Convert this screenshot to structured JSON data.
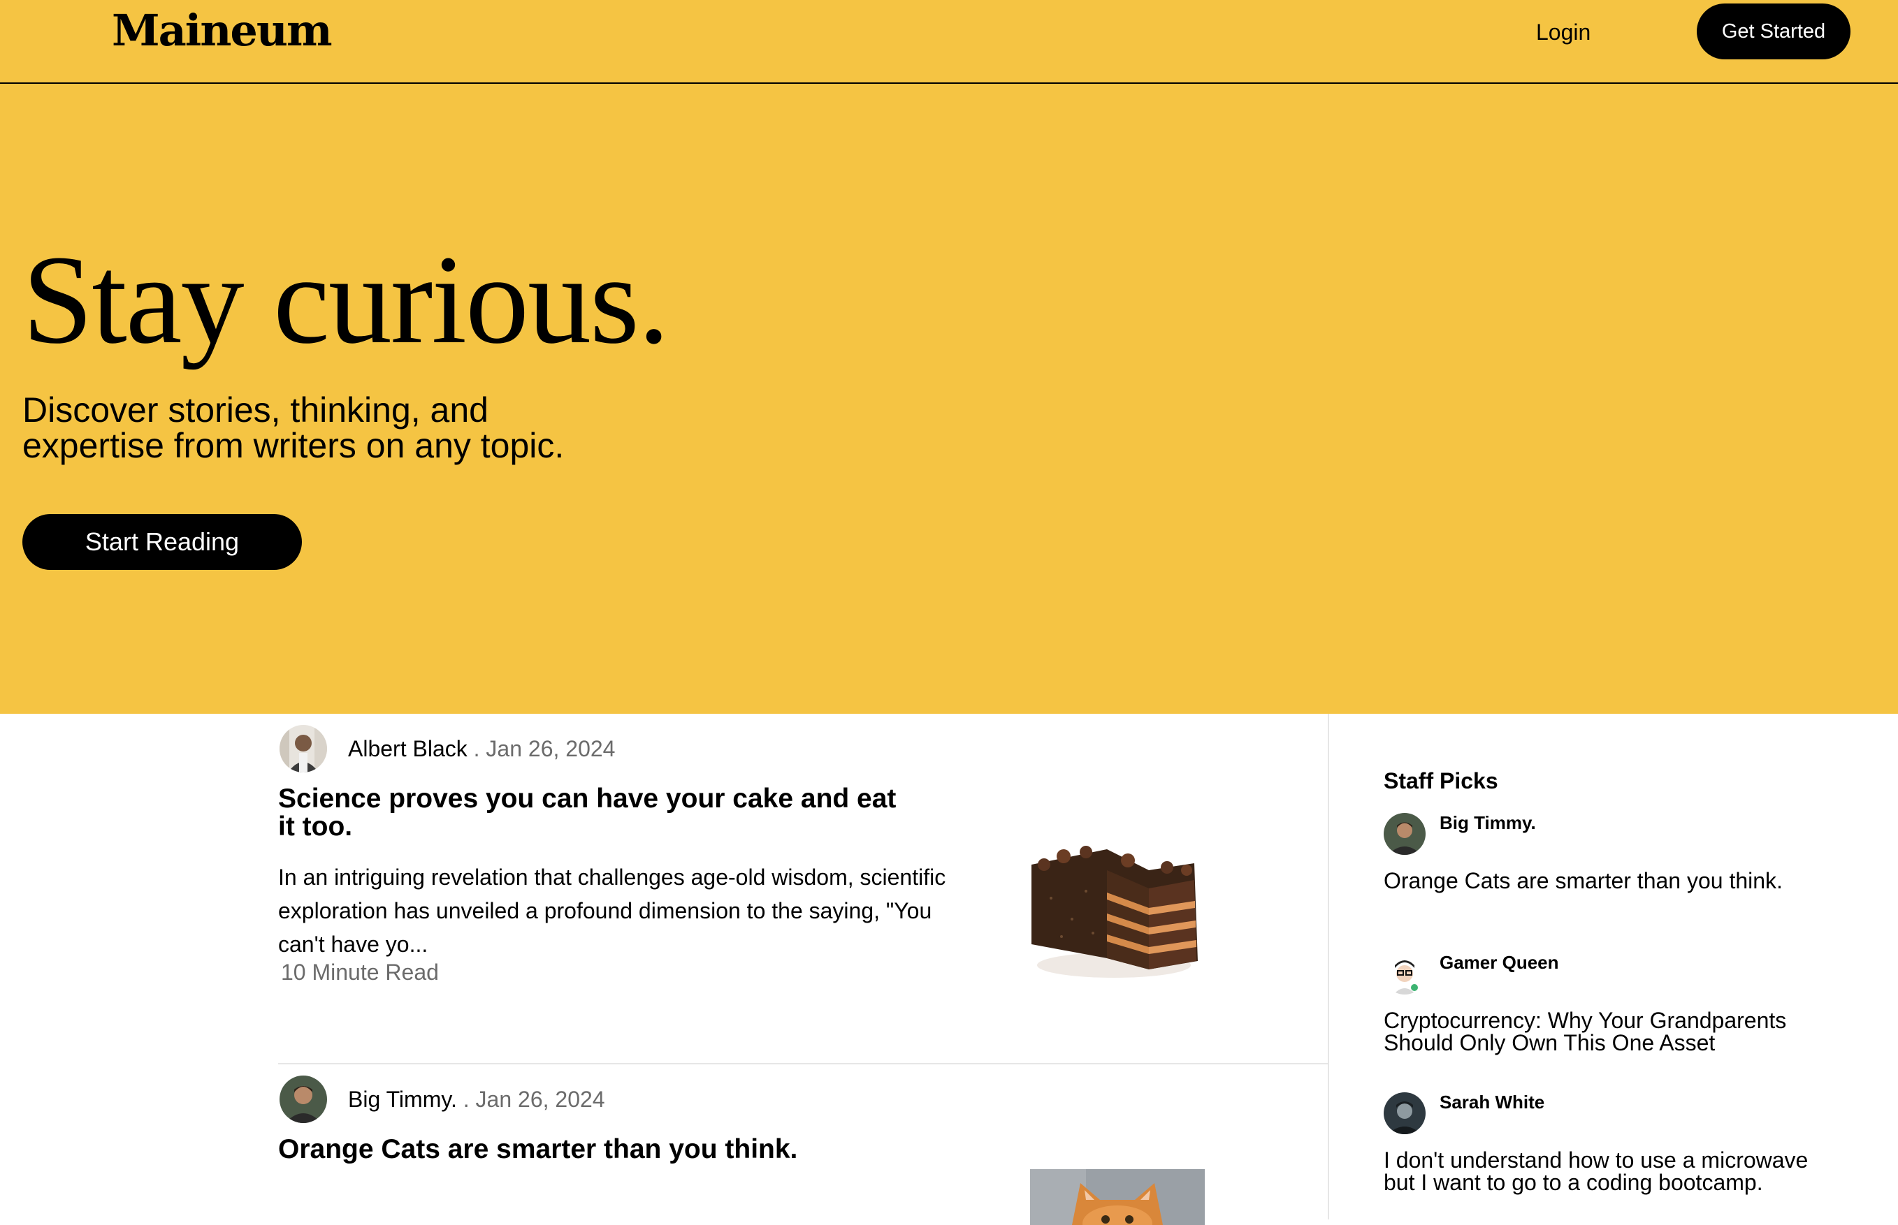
{
  "header": {
    "logo": "Maineum",
    "login_label": "Login",
    "cta_label": "Get Started"
  },
  "hero": {
    "title": "Stay curious.",
    "subtitle": "Discover stories, thinking, and expertise from writers on any topic.",
    "cta_label": "Start Reading"
  },
  "articles": [
    {
      "author": "Albert Black",
      "date": ". Jan 26, 2024",
      "title": "Science proves you can have your cake and eat it too.",
      "excerpt": "In an intriguing revelation that challenges age-old wisdom, scientific exploration has unveiled a profound dimension to the saying, \"You can't have yo...",
      "read_time": "10 Minute Read",
      "thumbnail": "chocolate-cake-image"
    },
    {
      "author": "Big Timmy.",
      "date": ". Jan 26, 2024",
      "title": "Orange Cats are smarter than you think.",
      "thumbnail": "orange-cat-image"
    }
  ],
  "staff_picks": {
    "title": "Staff Picks",
    "items": [
      {
        "author": "Big Timmy.",
        "title": "Orange Cats are smarter than you think."
      },
      {
        "author": "Gamer Queen",
        "title": "Cryptocurrency: Why Your Grandparents Should Only Own This One Asset"
      },
      {
        "author": "Sarah White",
        "title": "I don't understand how to use a microwave but I want to go to a coding bootcamp."
      }
    ]
  },
  "colors": {
    "brand_yellow": "#f5c443",
    "button_black": "#000000",
    "muted_text": "#6b6b6b"
  }
}
